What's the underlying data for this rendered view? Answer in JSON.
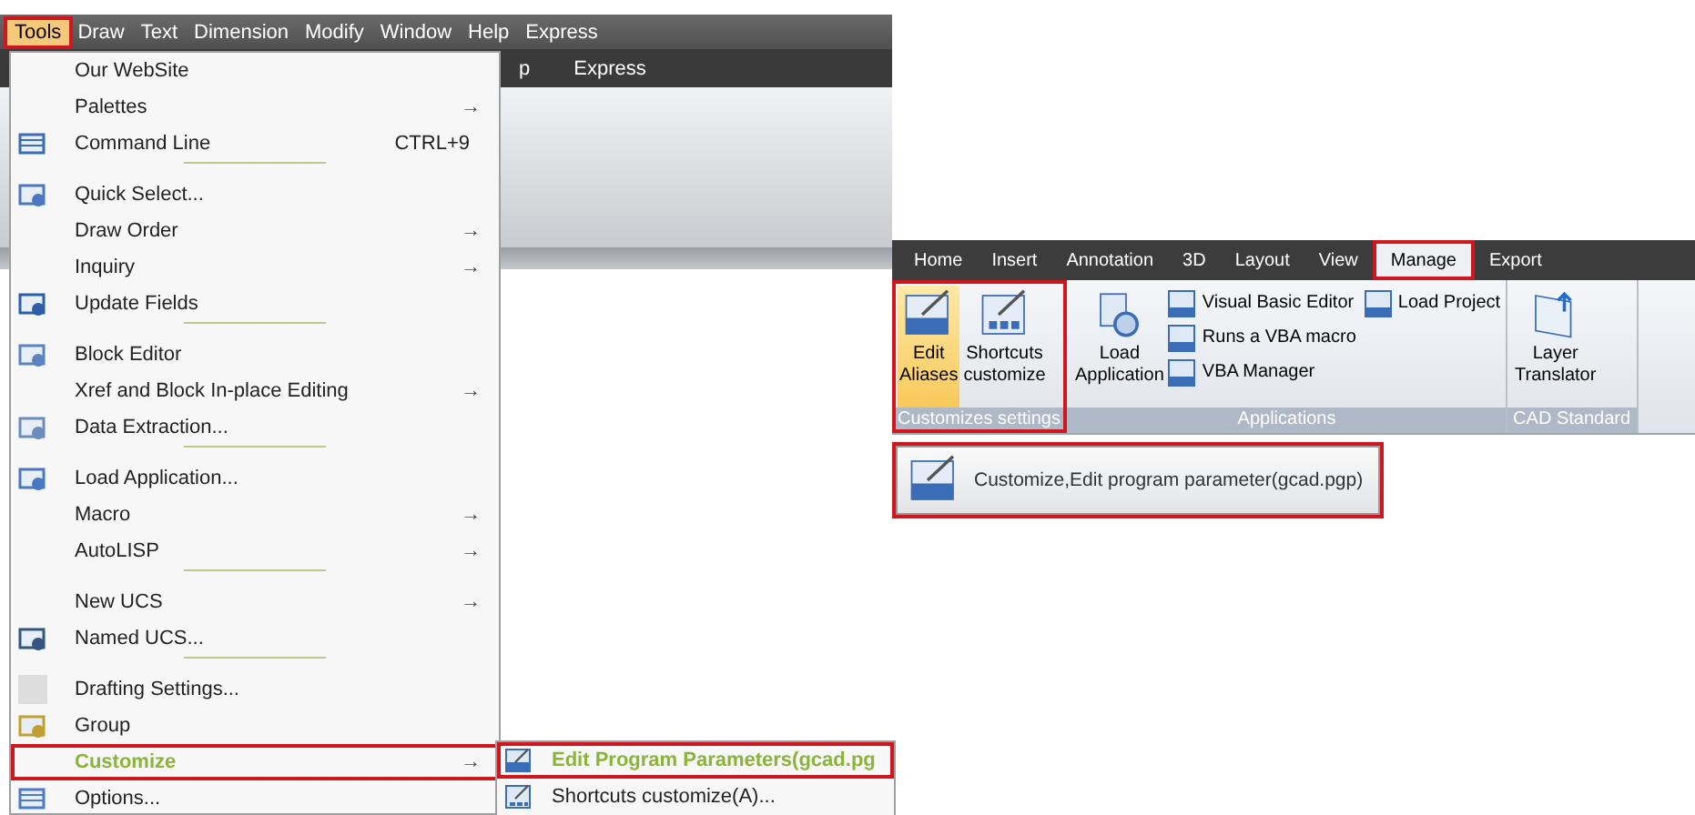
{
  "menu_bar": [
    {
      "label": "Tools",
      "selected": true
    },
    {
      "label": "Draw",
      "selected": false
    },
    {
      "label": "Text",
      "selected": false
    },
    {
      "label": "Dimension",
      "selected": false
    },
    {
      "label": "Modify",
      "selected": false
    },
    {
      "label": "Window",
      "selected": false
    },
    {
      "label": "Help",
      "selected": false
    },
    {
      "label": "Express",
      "selected": false
    }
  ],
  "background_tabs": [
    "p",
    "Express"
  ],
  "tools_menu": [
    {
      "kind": "item",
      "label": "Our WebSite",
      "highlighted": false
    },
    {
      "kind": "item",
      "label": "Palettes",
      "arrow": "→",
      "highlighted": false
    },
    {
      "kind": "item",
      "label": "Command Line",
      "shortcut": "CTRL+9",
      "highlighted": false
    },
    {
      "kind": "separator"
    },
    {
      "kind": "item",
      "label": "Quick Select...",
      "highlighted": false
    },
    {
      "kind": "item",
      "label": "Draw Order",
      "arrow": "→",
      "highlighted": false
    },
    {
      "kind": "item",
      "label": "Inquiry",
      "arrow": "→",
      "highlighted": false
    },
    {
      "kind": "item",
      "label": "Update Fields",
      "highlighted": false
    },
    {
      "kind": "separator"
    },
    {
      "kind": "item",
      "label": "Block Editor",
      "highlighted": false
    },
    {
      "kind": "item",
      "label": "Xref and Block In-place Editing",
      "arrow": "→",
      "highlighted": false
    },
    {
      "kind": "item",
      "label": "Data Extraction...",
      "highlighted": false
    },
    {
      "kind": "separator"
    },
    {
      "kind": "item",
      "label": "Load Application...",
      "highlighted": false
    },
    {
      "kind": "item",
      "label": "Macro",
      "arrow": "→",
      "highlighted": false
    },
    {
      "kind": "item",
      "label": "AutoLISP",
      "arrow": "→",
      "highlighted": false
    },
    {
      "kind": "separator"
    },
    {
      "kind": "item",
      "label": "New UCS",
      "arrow": "→",
      "highlighted": false
    },
    {
      "kind": "item",
      "label": "Named UCS...",
      "highlighted": false
    },
    {
      "kind": "separator"
    },
    {
      "kind": "item",
      "label": "Drafting Settings...",
      "highlighted": false
    },
    {
      "kind": "item",
      "label": "Group",
      "highlighted": false
    },
    {
      "kind": "item",
      "label": "Customize",
      "arrow": "→",
      "highlighted": true
    },
    {
      "kind": "item",
      "label": "Options...",
      "highlighted": false
    }
  ],
  "customize_submenu": [
    {
      "label": "Edit Program Parameters(gcad.pg",
      "highlighted": true
    },
    {
      "label": "Shortcuts customize(A)...",
      "highlighted": false
    }
  ],
  "ribbon": {
    "tabs": [
      {
        "label": "Home",
        "selected": false
      },
      {
        "label": "Insert",
        "selected": false
      },
      {
        "label": "Annotation",
        "selected": false
      },
      {
        "label": "3D",
        "selected": false
      },
      {
        "label": "Layout",
        "selected": false
      },
      {
        "label": "View",
        "selected": false
      },
      {
        "label": "Manage",
        "selected": true
      },
      {
        "label": "Export",
        "selected": false
      }
    ],
    "panels": [
      {
        "title": "Customizes settings",
        "highlighted": true,
        "large": [
          {
            "label": "Edit Aliases",
            "selected": true
          },
          {
            "label": "Shortcuts customize",
            "selected": false
          }
        ]
      },
      {
        "title": "Applications",
        "highlighted": false,
        "large": [
          {
            "label": "Load Application",
            "selected": false
          }
        ],
        "small": [
          "Visual Basic Editor",
          "Runs a VBA macro",
          "VBA Manager",
          "Load Project"
        ]
      },
      {
        "title": "CAD Standard",
        "highlighted": false,
        "large": [
          {
            "label": "Layer Translator",
            "selected": false
          }
        ]
      }
    ]
  },
  "tooltip": {
    "text": "Customize,Edit program parameter(gcad.pgp)",
    "highlighted": true
  }
}
